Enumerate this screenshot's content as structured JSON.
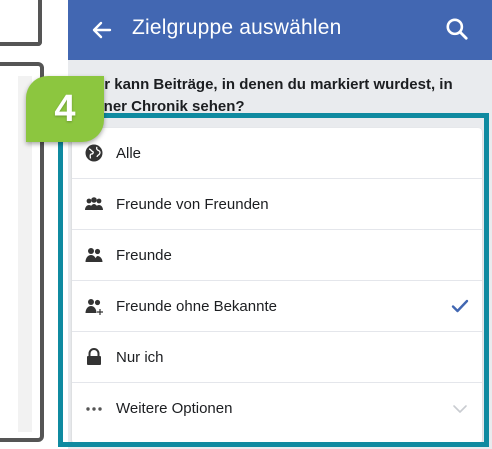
{
  "header": {
    "title": "Zielgruppe auswählen",
    "back_icon": "arrow-left-icon",
    "search_icon": "search-icon"
  },
  "question": "Wer kann Beiträge, in denen du markiert wurdest, in deiner Chronik sehen?",
  "step_badge": "4",
  "colors": {
    "header_bg": "#4267b2",
    "badge": "#8cc63f",
    "highlight": "#0f8aa0",
    "check": "#4267b2"
  },
  "options": [
    {
      "label": "Alle",
      "icon": "globe-icon"
    },
    {
      "label": "Freunde von Freunden",
      "icon": "friends-of-friends-icon"
    },
    {
      "label": "Freunde",
      "icon": "friends-icon"
    },
    {
      "label": "Freunde ohne Bekannte",
      "icon": "friends-except-icon",
      "selected": true
    },
    {
      "label": "Nur ich",
      "icon": "lock-icon"
    },
    {
      "label": "Weitere Optionen",
      "icon": "more-dots-icon",
      "expandable": true
    }
  ]
}
